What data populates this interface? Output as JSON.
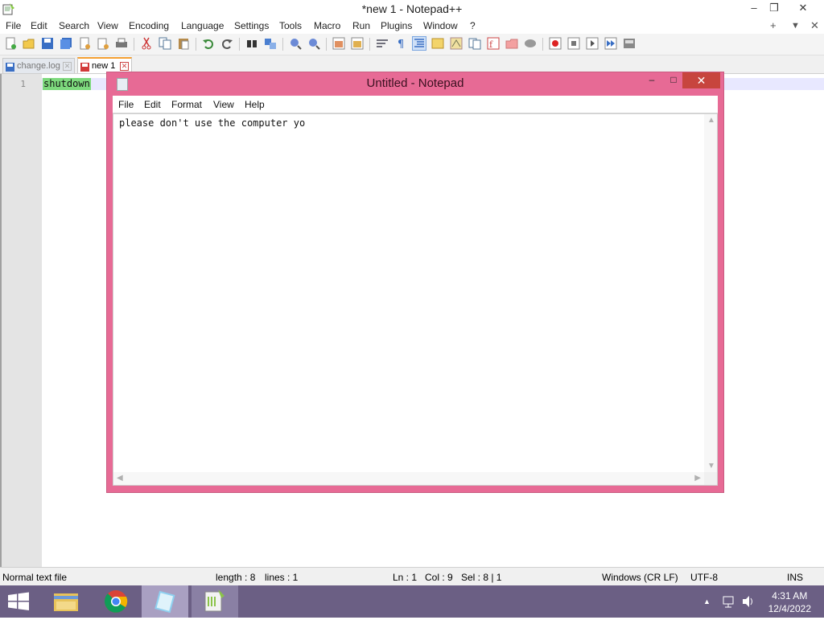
{
  "npp": {
    "title": "*new 1 - Notepad++",
    "window_buttons": {
      "minimize": "–",
      "restore": "❐",
      "close": "✕"
    },
    "menu": [
      "File",
      "Edit",
      "Search",
      "View",
      "Encoding",
      "Language",
      "Settings",
      "Tools",
      "Macro",
      "Run",
      "Plugins",
      "Window",
      "?"
    ],
    "menu_right": {
      "add": "+",
      "dropdown": "▼",
      "close": "✕"
    },
    "tabs": [
      {
        "label": "change.log",
        "active": false
      },
      {
        "label": "new 1",
        "active": true
      }
    ],
    "editor": {
      "line_number": "1",
      "line_text": "shutdown"
    },
    "status": {
      "file_type": "Normal text file",
      "length": "length : 8",
      "lines": "lines : 1",
      "ln": "Ln : 1",
      "col": "Col : 9",
      "sel": "Sel : 8 | 1",
      "eol": "Windows (CR LF)",
      "encoding": "UTF-8",
      "mode": "INS"
    }
  },
  "notepad": {
    "title": "Untitled - Notepad",
    "menu": [
      "File",
      "Edit",
      "Format",
      "View",
      "Help"
    ],
    "text": "please don't use the computer yo",
    "buttons": {
      "minimize": "–",
      "maximize": "□",
      "close": "✕"
    }
  },
  "taskbar": {
    "time": "4:31 AM",
    "date": "12/4/2022",
    "apps": [
      "start-icon",
      "file-explorer-icon",
      "chrome-icon",
      "notepad-icon",
      "notepadpp-icon"
    ]
  },
  "colors": {
    "notepad_frame": "#e76a95",
    "notepad_close": "#c7453e",
    "taskbar": "#6b5f84",
    "selection_highlight": "#7dd97d",
    "current_line": "#e8e8ff",
    "active_tab_accent": "#f5a033"
  }
}
